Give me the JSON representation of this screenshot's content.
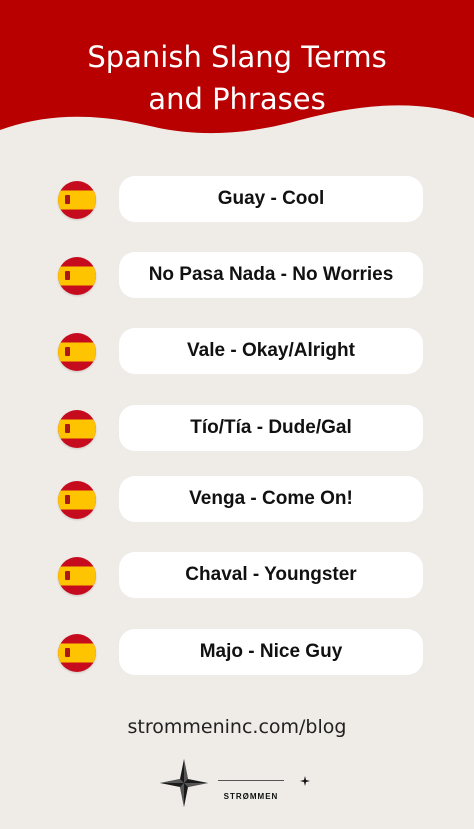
{
  "header": {
    "title_line1": "Spanish Slang Terms",
    "title_line2": "and Phrases",
    "bg_color": "#b80000"
  },
  "items": [
    {
      "label": "Guay - Cool",
      "icon": "spain-flag-icon"
    },
    {
      "label": "No Pasa Nada - No Worries",
      "icon": "spain-flag-icon"
    },
    {
      "label": "Vale - Okay/Alright",
      "icon": "spain-flag-icon"
    },
    {
      "label": "Tío/Tía - Dude/Gal",
      "icon": "spain-flag-icon"
    },
    {
      "label": "Venga - Come On!",
      "icon": "spain-flag-icon"
    },
    {
      "label": "Chaval - Youngster",
      "icon": "spain-flag-icon"
    },
    {
      "label": "Majo - Nice Guy",
      "icon": "spain-flag-icon"
    }
  ],
  "footer": {
    "url": "strommeninc.com/blog",
    "brand": "STRØMMEN"
  },
  "colors": {
    "flag_red": "#c60b1e",
    "flag_yellow": "#ffc400",
    "background": "#efebe7"
  }
}
